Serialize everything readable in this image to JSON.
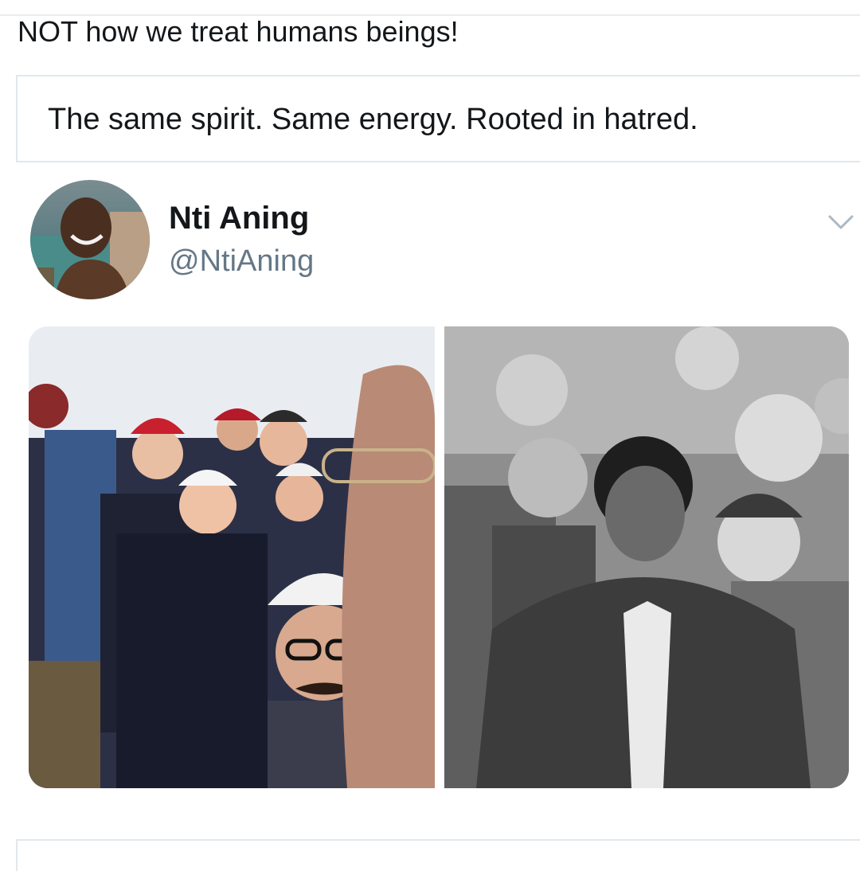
{
  "tweet": {
    "text": "NOT how we treat humans beings!"
  },
  "quoted_tweet": {
    "text": "The same spirit. Same energy. Rooted in hatred."
  },
  "embedded_tweet": {
    "display_name": "Nti Aning",
    "handle": "@NtiAning",
    "menu_icon": "chevron-down-icon",
    "accent_color": "#14171a",
    "secondary_text_color": "#657786"
  }
}
